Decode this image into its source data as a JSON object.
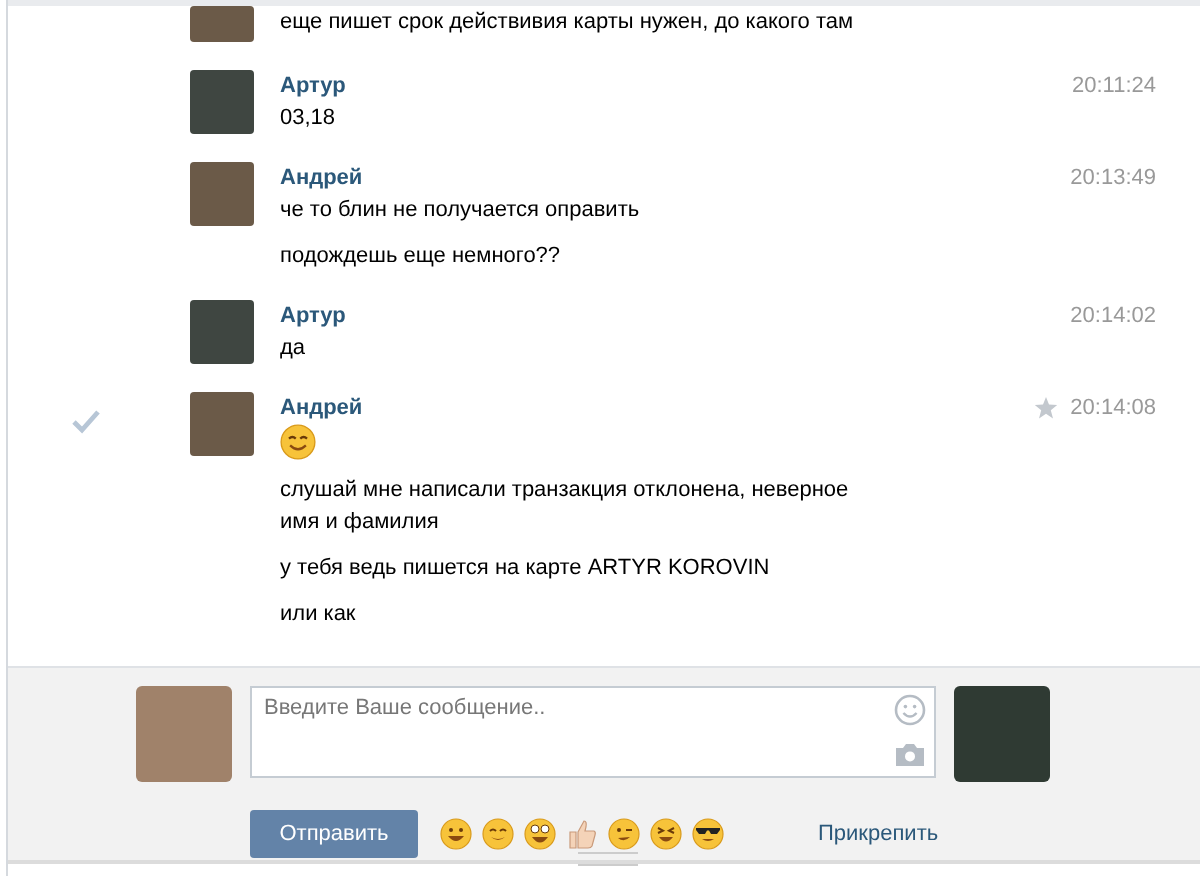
{
  "messages": [
    {
      "selected": false,
      "cut_top": true,
      "paragraphs": [
        {
          "kind": "text",
          "text": "еще пишет срок действивия карты нужен, до какого там"
        }
      ]
    },
    {
      "author": "Артур",
      "time": "20:11:24",
      "selected": false,
      "cut_top": false,
      "paragraphs": [
        {
          "kind": "text",
          "text": "03,18"
        }
      ]
    },
    {
      "author": "Андрей",
      "time": "20:13:49",
      "selected": false,
      "cut_top": false,
      "paragraphs": [
        {
          "kind": "text",
          "text": "че то блин не получается оправить"
        },
        {
          "kind": "text",
          "text": "подождешь еще немного??"
        }
      ]
    },
    {
      "author": "Артур",
      "time": "20:14:02",
      "selected": false,
      "cut_top": false,
      "paragraphs": [
        {
          "kind": "text",
          "text": "да"
        }
      ]
    },
    {
      "author": "Андрей",
      "time": "20:14:08",
      "selected": true,
      "cut_top": false,
      "paragraphs": [
        {
          "kind": "smiley"
        },
        {
          "kind": "text",
          "text": "слушай мне написали транзакция отклонена, неверное имя и фамилия"
        },
        {
          "kind": "text",
          "text": "у тебя ведь пишется на карте ARTYR KOROVIN"
        },
        {
          "kind": "text",
          "text": "или как"
        }
      ]
    }
  ],
  "composer": {
    "placeholder": "Введите Ваше сообщение..",
    "send_button": "Отправить",
    "attach_link": "Прикрепить"
  }
}
